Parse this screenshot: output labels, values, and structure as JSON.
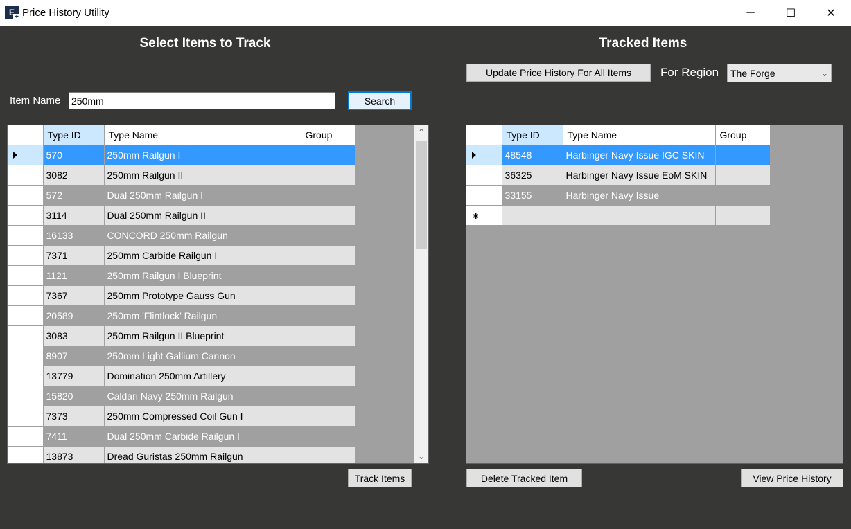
{
  "window": {
    "title": "Price History Utility",
    "icon_letter": "E",
    "icon_plus": "+",
    "min": "─",
    "max": "☐",
    "close": "✕"
  },
  "left": {
    "heading": "Select Items to Track",
    "item_name_label": "Item Name",
    "search_value": "250mm",
    "search_button": "Search",
    "track_button": "Track Items",
    "columns": [
      "Type ID",
      "Type Name",
      "Group"
    ],
    "rows": [
      {
        "id": "570",
        "name": "250mm Railgun I",
        "group": ""
      },
      {
        "id": "3082",
        "name": "250mm Railgun II",
        "group": ""
      },
      {
        "id": "572",
        "name": "Dual 250mm Railgun I",
        "group": ""
      },
      {
        "id": "3114",
        "name": "Dual 250mm Railgun II",
        "group": ""
      },
      {
        "id": "16133",
        "name": "CONCORD 250mm Railgun",
        "group": ""
      },
      {
        "id": "7371",
        "name": "250mm Carbide Railgun I",
        "group": ""
      },
      {
        "id": "1121",
        "name": "250mm Railgun I Blueprint",
        "group": ""
      },
      {
        "id": "7367",
        "name": "250mm Prototype Gauss Gun",
        "group": ""
      },
      {
        "id": "20589",
        "name": "250mm 'Flintlock' Railgun",
        "group": ""
      },
      {
        "id": "3083",
        "name": "250mm Railgun II Blueprint",
        "group": ""
      },
      {
        "id": "8907",
        "name": "250mm Light Gallium Cannon",
        "group": ""
      },
      {
        "id": "13779",
        "name": "Domination 250mm Artillery",
        "group": ""
      },
      {
        "id": "15820",
        "name": "Caldari Navy 250mm Railgun",
        "group": ""
      },
      {
        "id": "7373",
        "name": "250mm Compressed Coil Gun I",
        "group": ""
      },
      {
        "id": "7411",
        "name": "Dual 250mm Carbide Railgun I",
        "group": ""
      },
      {
        "id": "13873",
        "name": "Dread Guristas 250mm Railgun",
        "group": ""
      }
    ]
  },
  "right": {
    "heading": "Tracked Items",
    "update_button": "Update Price History For All Items",
    "region_label": "For Region",
    "region_value": "The Forge",
    "delete_button": "Delete Tracked Item",
    "view_button": "View Price History",
    "columns": [
      "Type ID",
      "Type Name",
      "Group"
    ],
    "rows": [
      {
        "id": "48548",
        "name": "Harbinger Navy Issue IGC SKIN",
        "group": ""
      },
      {
        "id": "36325",
        "name": "Harbinger Navy Issue EoM SKIN",
        "group": ""
      },
      {
        "id": "33155",
        "name": "Harbinger Navy Issue",
        "group": ""
      }
    ],
    "new_row_marker": "✱"
  }
}
